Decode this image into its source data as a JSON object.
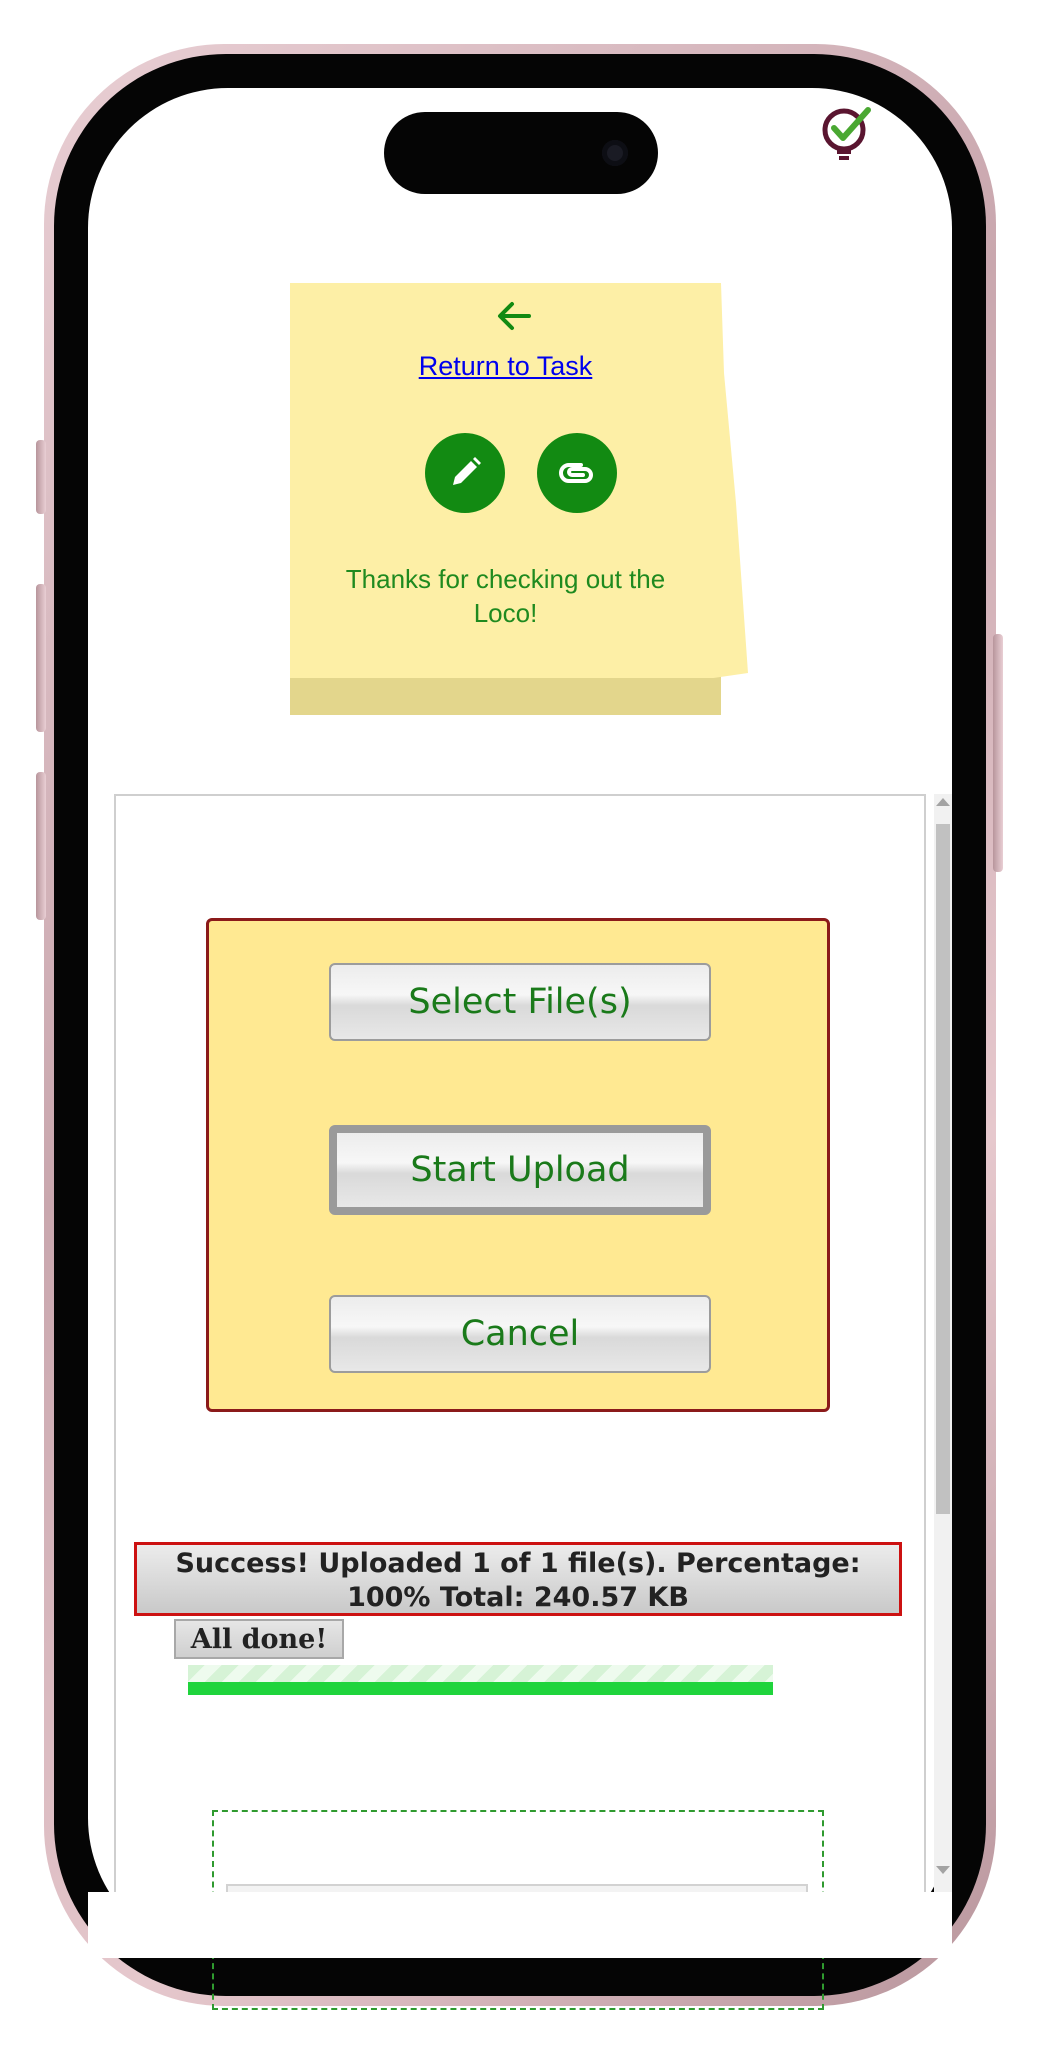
{
  "note": {
    "return_label": "Return to Task",
    "message": "Thanks for checking out the Loco!"
  },
  "icons": {
    "back": "arrow-left-icon",
    "edit": "pencil-icon",
    "attach": "paperclip-icon",
    "logo": "lightbulb-check-icon"
  },
  "uploader": {
    "select_label": "Select File(s)",
    "start_label": "Start Upload",
    "cancel_label": "Cancel",
    "status_text": "Success! Uploaded 1 of 1 file(s). Percentage: 100% Total: 240.57 KB",
    "done_label": "All done!",
    "progress_percent": 100
  },
  "colors": {
    "accent_green": "#128a12",
    "note_yellow": "#fdefa6",
    "upload_box": "#ffe992",
    "status_border": "#cc1111",
    "progress_green": "#1fd43c"
  }
}
